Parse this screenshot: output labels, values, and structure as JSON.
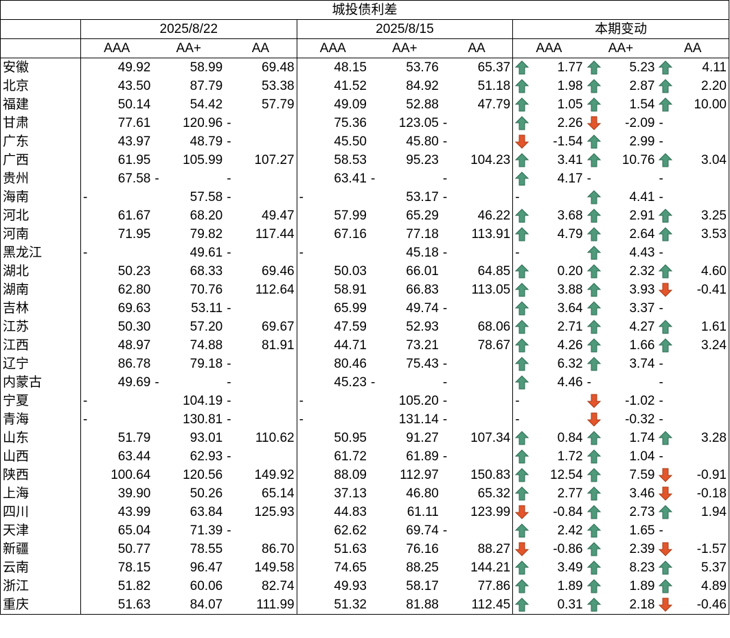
{
  "title": "城投债利差",
  "dates": [
    "2025/8/22",
    "2025/8/15"
  ],
  "change_header": "本期变动",
  "ratings": [
    "AAA",
    "AA+",
    "AA"
  ],
  "colors": {
    "up": "#4e9a7b",
    "down": "#e3562b"
  },
  "rows": [
    {
      "name": "安徽",
      "cur": [
        "49.92",
        "58.99",
        "69.48"
      ],
      "prev": [
        "48.15",
        "53.76",
        "65.37"
      ],
      "chg": [
        "1.77",
        "5.23",
        "4.11"
      ]
    },
    {
      "name": "北京",
      "cur": [
        "43.50",
        "87.79",
        "53.38"
      ],
      "prev": [
        "41.52",
        "84.92",
        "51.18"
      ],
      "chg": [
        "1.98",
        "2.87",
        "2.20"
      ]
    },
    {
      "name": "福建",
      "cur": [
        "50.14",
        "54.42",
        "57.79"
      ],
      "prev": [
        "49.09",
        "52.88",
        "47.79"
      ],
      "chg": [
        "1.05",
        "1.54",
        "10.00"
      ]
    },
    {
      "name": "甘肃",
      "cur": [
        "77.61",
        "120.96",
        "-"
      ],
      "prev": [
        "75.36",
        "123.05",
        "-"
      ],
      "chg": [
        "2.26",
        "-2.09",
        "-"
      ]
    },
    {
      "name": "广东",
      "cur": [
        "43.97",
        "48.79",
        "-"
      ],
      "prev": [
        "45.50",
        "45.80",
        "-"
      ],
      "chg": [
        "-1.54",
        "2.99",
        "-"
      ]
    },
    {
      "name": "广西",
      "cur": [
        "61.95",
        "105.99",
        "107.27"
      ],
      "prev": [
        "58.53",
        "95.23",
        "104.23"
      ],
      "chg": [
        "3.41",
        "10.76",
        "3.04"
      ]
    },
    {
      "name": "贵州",
      "cur": [
        "67.58",
        "-",
        "-"
      ],
      "prev": [
        "63.41",
        "-",
        "-"
      ],
      "chg": [
        "4.17",
        "-",
        "-"
      ]
    },
    {
      "name": "海南",
      "cur": [
        "-",
        "57.58",
        "-"
      ],
      "prev": [
        "-",
        "53.17",
        "-"
      ],
      "chg": [
        "-",
        "4.41",
        "-"
      ]
    },
    {
      "name": "河北",
      "cur": [
        "61.67",
        "68.20",
        "49.47"
      ],
      "prev": [
        "57.99",
        "65.29",
        "46.22"
      ],
      "chg": [
        "3.68",
        "2.91",
        "3.25"
      ]
    },
    {
      "name": "河南",
      "cur": [
        "71.95",
        "79.82",
        "117.44"
      ],
      "prev": [
        "67.16",
        "77.18",
        "113.91"
      ],
      "chg": [
        "4.79",
        "2.64",
        "3.53"
      ]
    },
    {
      "name": "黑龙江",
      "cur": [
        "-",
        "49.61",
        "-"
      ],
      "prev": [
        "-",
        "45.18",
        "-"
      ],
      "chg": [
        "-",
        "4.43",
        "-"
      ]
    },
    {
      "name": "湖北",
      "cur": [
        "50.23",
        "68.33",
        "69.46"
      ],
      "prev": [
        "50.03",
        "66.01",
        "64.85"
      ],
      "chg": [
        "0.20",
        "2.32",
        "4.60"
      ]
    },
    {
      "name": "湖南",
      "cur": [
        "62.80",
        "70.76",
        "112.64"
      ],
      "prev": [
        "58.91",
        "66.83",
        "113.05"
      ],
      "chg": [
        "3.88",
        "3.93",
        "-0.41"
      ]
    },
    {
      "name": "吉林",
      "cur": [
        "69.63",
        "53.11",
        "-"
      ],
      "prev": [
        "65.99",
        "49.74",
        "-"
      ],
      "chg": [
        "3.64",
        "3.37",
        "-"
      ]
    },
    {
      "name": "江苏",
      "cur": [
        "50.30",
        "57.20",
        "69.67"
      ],
      "prev": [
        "47.59",
        "52.93",
        "68.06"
      ],
      "chg": [
        "2.71",
        "4.27",
        "1.61"
      ]
    },
    {
      "name": "江西",
      "cur": [
        "48.97",
        "74.88",
        "81.91"
      ],
      "prev": [
        "44.71",
        "73.21",
        "78.67"
      ],
      "chg": [
        "4.26",
        "1.66",
        "3.24"
      ]
    },
    {
      "name": "辽宁",
      "cur": [
        "86.78",
        "79.18",
        "-"
      ],
      "prev": [
        "80.46",
        "75.43",
        "-"
      ],
      "chg": [
        "6.32",
        "3.74",
        "-"
      ]
    },
    {
      "name": "内蒙古",
      "cur": [
        "49.69",
        "-",
        "-"
      ],
      "prev": [
        "45.23",
        "-",
        "-"
      ],
      "chg": [
        "4.46",
        "-",
        "-"
      ]
    },
    {
      "name": "宁夏",
      "cur": [
        "-",
        "104.19",
        "-"
      ],
      "prev": [
        "-",
        "105.20",
        "-"
      ],
      "chg": [
        "-",
        "-1.02",
        "-"
      ]
    },
    {
      "name": "青海",
      "cur": [
        "-",
        "130.81",
        "-"
      ],
      "prev": [
        "-",
        "131.14",
        "-"
      ],
      "chg": [
        "-",
        "-0.32",
        "-"
      ]
    },
    {
      "name": "山东",
      "cur": [
        "51.79",
        "93.01",
        "110.62"
      ],
      "prev": [
        "50.95",
        "91.27",
        "107.34"
      ],
      "chg": [
        "0.84",
        "1.74",
        "3.28"
      ]
    },
    {
      "name": "山西",
      "cur": [
        "63.44",
        "62.93",
        "-"
      ],
      "prev": [
        "61.72",
        "61.89",
        "-"
      ],
      "chg": [
        "1.72",
        "1.04",
        "-"
      ]
    },
    {
      "name": "陕西",
      "cur": [
        "100.64",
        "120.56",
        "149.92"
      ],
      "prev": [
        "88.09",
        "112.97",
        "150.83"
      ],
      "chg": [
        "12.54",
        "7.59",
        "-0.91"
      ]
    },
    {
      "name": "上海",
      "cur": [
        "39.90",
        "50.26",
        "65.14"
      ],
      "prev": [
        "37.13",
        "46.80",
        "65.32"
      ],
      "chg": [
        "2.77",
        "3.46",
        "-0.18"
      ]
    },
    {
      "name": "四川",
      "cur": [
        "43.99",
        "63.84",
        "125.93"
      ],
      "prev": [
        "44.83",
        "61.11",
        "123.99"
      ],
      "chg": [
        "-0.84",
        "2.73",
        "1.94"
      ]
    },
    {
      "name": "天津",
      "cur": [
        "65.04",
        "71.39",
        "-"
      ],
      "prev": [
        "62.62",
        "69.74",
        "-"
      ],
      "chg": [
        "2.42",
        "1.65",
        "-"
      ]
    },
    {
      "name": "新疆",
      "cur": [
        "50.77",
        "78.55",
        "86.70"
      ],
      "prev": [
        "51.63",
        "76.16",
        "88.27"
      ],
      "chg": [
        "-0.86",
        "2.39",
        "-1.57"
      ]
    },
    {
      "name": "云南",
      "cur": [
        "78.15",
        "96.47",
        "149.58"
      ],
      "prev": [
        "74.65",
        "88.25",
        "144.21"
      ],
      "chg": [
        "3.49",
        "8.23",
        "5.37"
      ]
    },
    {
      "name": "浙江",
      "cur": [
        "51.82",
        "60.06",
        "82.74"
      ],
      "prev": [
        "49.93",
        "58.17",
        "77.86"
      ],
      "chg": [
        "1.89",
        "1.89",
        "4.89"
      ]
    },
    {
      "name": "重庆",
      "cur": [
        "51.63",
        "84.07",
        "111.99"
      ],
      "prev": [
        "51.32",
        "81.88",
        "112.45"
      ],
      "chg": [
        "0.31",
        "2.18",
        "-0.46"
      ]
    }
  ]
}
